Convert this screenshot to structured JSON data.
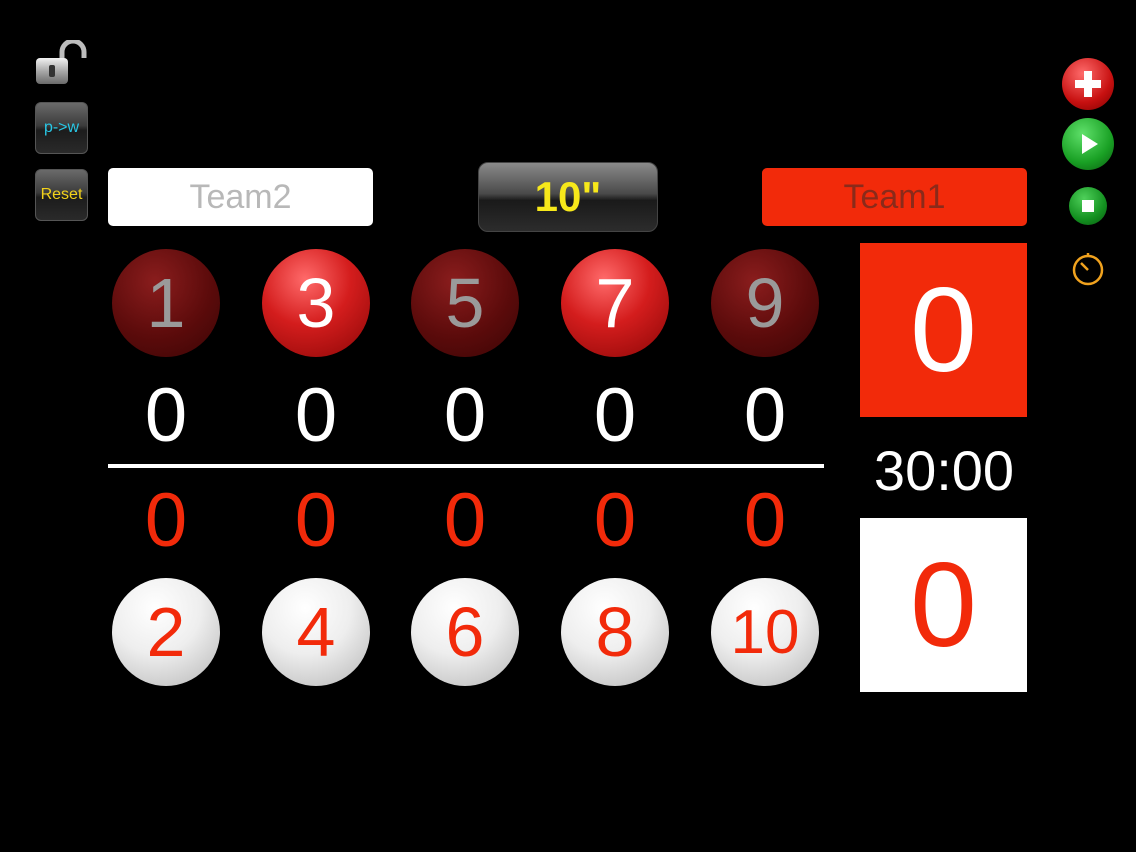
{
  "toolbar": {
    "pw_label": "p->w",
    "reset_label": "Reset"
  },
  "teams": {
    "left_name": "Team2",
    "right_name": "Team1"
  },
  "shot_clock": "10\"",
  "top_balls": [
    "1",
    "3",
    "5",
    "7",
    "9"
  ],
  "top_counts": [
    "0",
    "0",
    "0",
    "0",
    "0"
  ],
  "bottom_counts": [
    "0",
    "0",
    "0",
    "0",
    "0"
  ],
  "bottom_balls": [
    "2",
    "4",
    "6",
    "8",
    "10"
  ],
  "scores": {
    "team1": "0",
    "team2": "0"
  },
  "game_clock": "30:00",
  "colors": {
    "team1": "#f22a0a",
    "team2": "#ffffff",
    "shot_clock_text": "#f7e81a"
  },
  "icons": [
    "unlock-icon",
    "plus-icon",
    "play-icon",
    "stop-icon",
    "stopwatch-icon"
  ]
}
